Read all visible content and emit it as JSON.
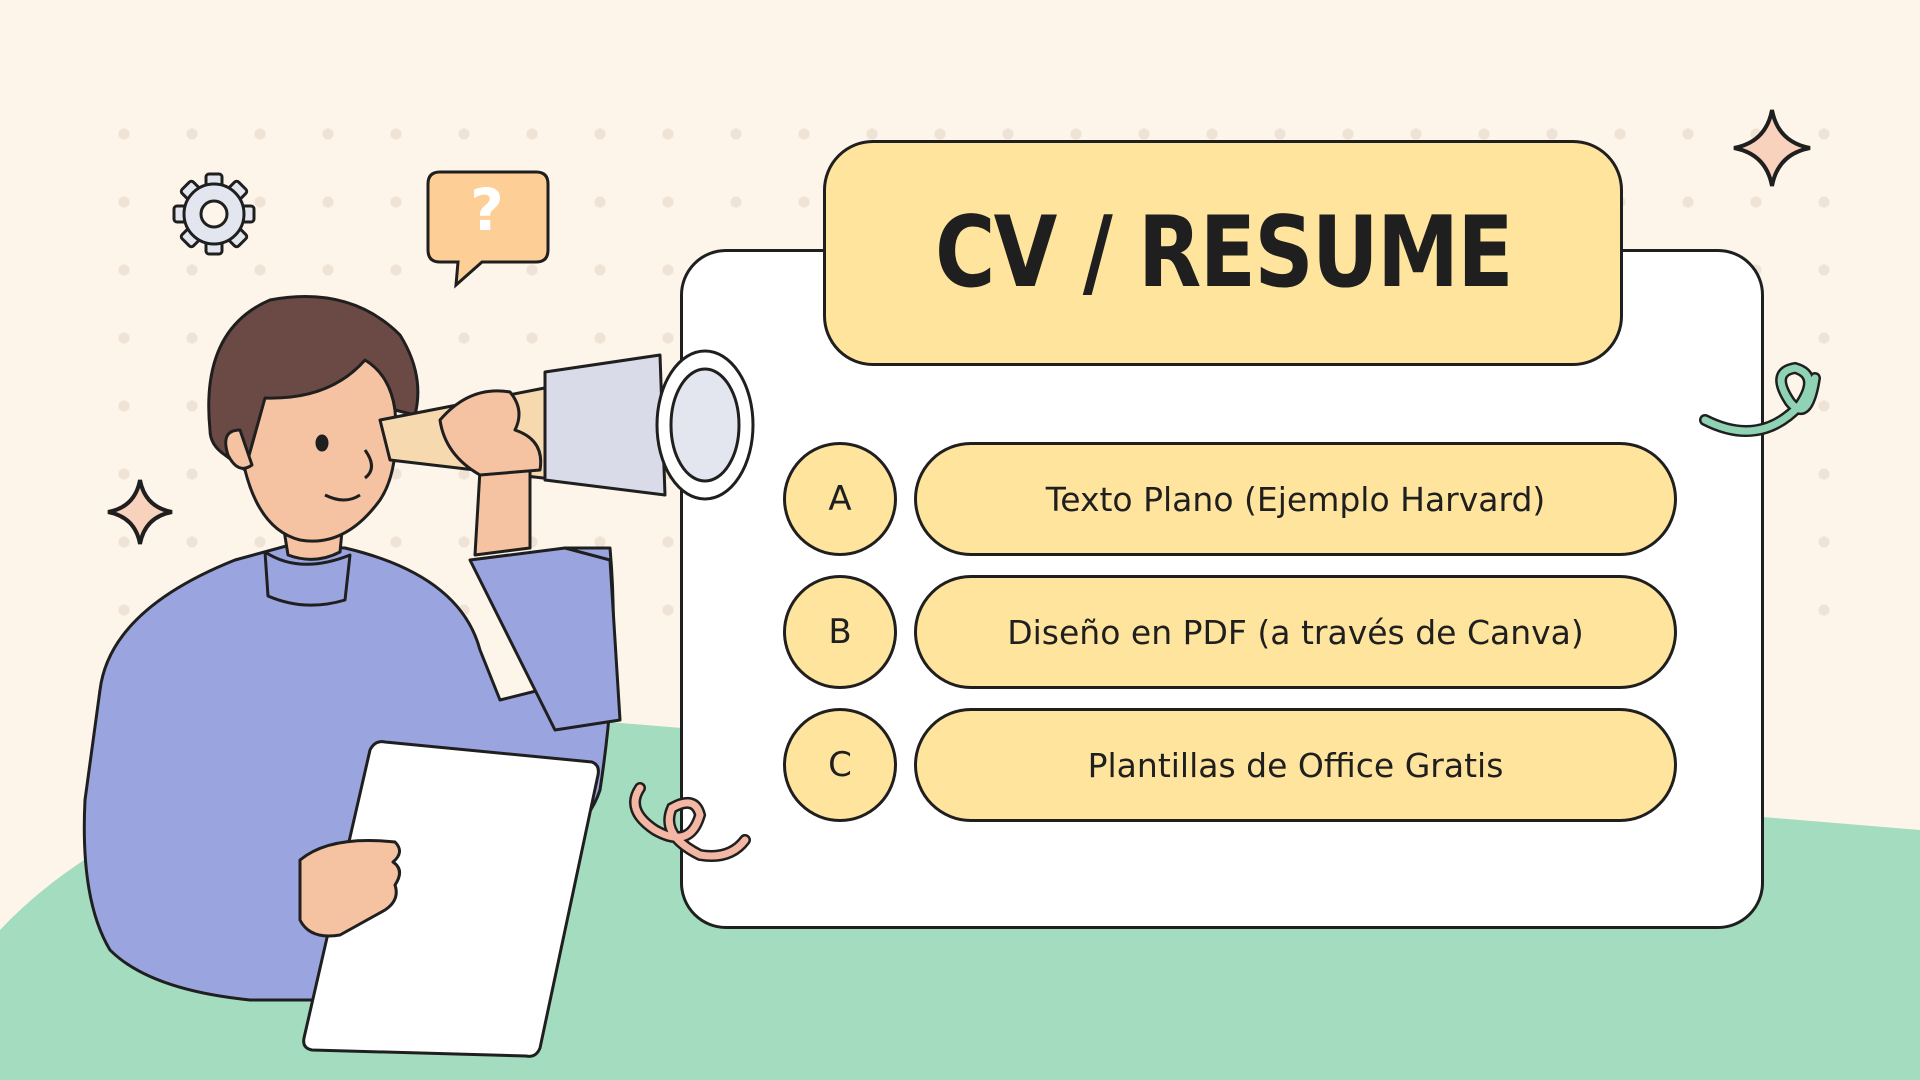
{
  "slide": {
    "title": "CV / RESUME",
    "options": [
      {
        "letter": "A",
        "label": "Texto Plano (Ejemplo Harvard)"
      },
      {
        "letter": "B",
        "label": "Diseño en PDF (a través de Canva)"
      },
      {
        "letter": "C",
        "label": "Plantillas de Office Gratis"
      }
    ]
  },
  "decor": {
    "speech_bubble_glyph": "?",
    "icons": [
      "gear-icon",
      "question-bubble-icon",
      "sparkle-icon",
      "squiggle-icon"
    ]
  },
  "colors": {
    "background": "#fdf4ea",
    "accent_yellow": "#fee49c",
    "ground_green": "#a3dcbe",
    "shirt_blue": "#9aa5e0",
    "skin": "#f5c3a2",
    "hair": "#6b4a46",
    "outline": "#1f1f1f"
  }
}
